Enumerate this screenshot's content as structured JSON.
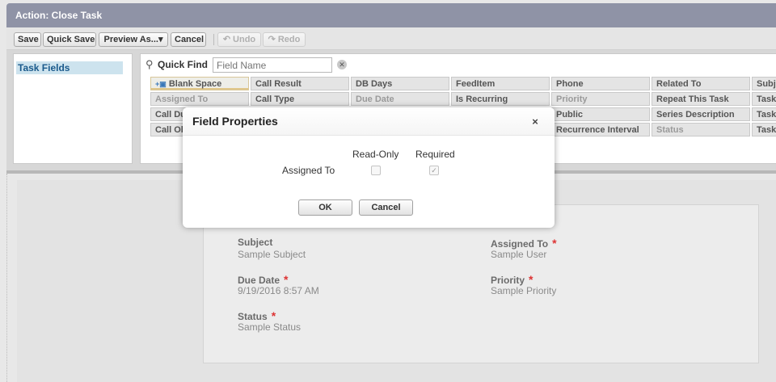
{
  "window": {
    "title": "Action: Close Task"
  },
  "toolbar": {
    "save": "Save",
    "quick_save": "Quick Save",
    "preview_as": "Preview As...",
    "dropdown_glyph": "▾",
    "cancel": "Cancel",
    "undo": "Undo",
    "redo": "Redo"
  },
  "palette": {
    "category": "Task Fields",
    "quick_find_label": "Quick Find",
    "quick_find_placeholder": "Field Name",
    "fields": {
      "row1": [
        "Blank Space",
        "Call Result",
        "DB Days",
        "FeedItem",
        "Phone",
        "Related To",
        "Subject"
      ],
      "row2": [
        "Assigned To",
        "Call Type",
        "Due Date",
        "Is Recurring",
        "Priority",
        "Repeat This Task",
        "TaskRelation"
      ],
      "row3": [
        "Call Duration",
        "Public",
        "Series Description",
        "Task Subtype"
      ],
      "row4": [
        "Call Object",
        "Recurrence Interval",
        "Status",
        "Task Source"
      ]
    }
  },
  "layout": {
    "fields": [
      {
        "label": "Subject",
        "value": "Sample Subject",
        "required": false
      },
      {
        "label": "Assigned To",
        "value": "Sample User",
        "required": true
      },
      {
        "label": "Due Date",
        "value": "9/19/2016 8:57 AM",
        "required": true
      },
      {
        "label": "Priority",
        "value": "Sample Priority",
        "required": true
      },
      {
        "label": "Status",
        "value": "Sample Status",
        "required": true
      }
    ],
    "required_marker": "*"
  },
  "dialog": {
    "title": "Field Properties",
    "close_glyph": "×",
    "col_readonly": "Read-Only",
    "col_required": "Required",
    "field_name": "Assigned To",
    "readonly_checked": false,
    "required_checked": true,
    "ok": "OK",
    "cancel": "Cancel"
  }
}
